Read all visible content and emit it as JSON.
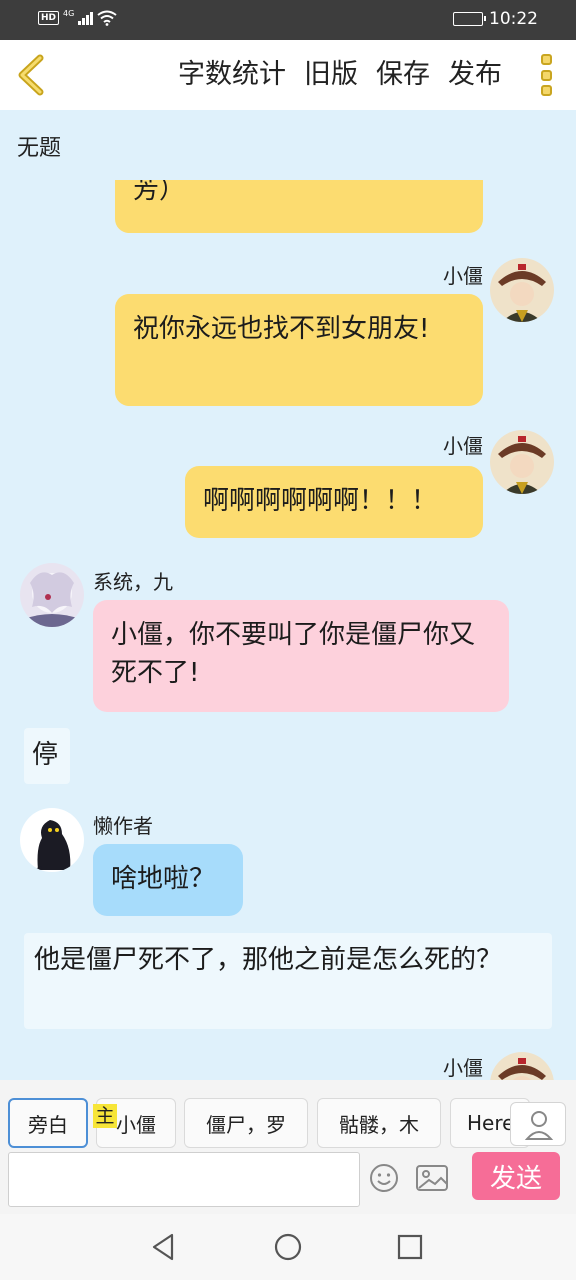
{
  "status_bar": {
    "hd": "HD",
    "network": "4G",
    "time": "10:22",
    "battery_level": 0.9
  },
  "toolbar": {
    "word_count": "字数统计",
    "old_version": "旧版",
    "save": "保存",
    "publish": "发布",
    "back_icon": "chevron-left-icon",
    "more_icon": "more-vertical-icon",
    "accent_color": "#f4d76a"
  },
  "story": {
    "title": "无题"
  },
  "messages": [
    {
      "type": "yellow",
      "text": "芳）"
    },
    {
      "type": "yellow",
      "speaker": "小僵",
      "text": "祝你永远也找不到女朋友!"
    },
    {
      "type": "yellow",
      "speaker": "小僵",
      "text": "啊啊啊啊啊啊！！！"
    },
    {
      "type": "pink",
      "speaker": "系统，九",
      "text": "小僵，你不要叫了你是僵尸你又死不了!"
    },
    {
      "type": "narration",
      "text": "停"
    },
    {
      "type": "blue",
      "speaker": "懒作者",
      "text": "啥地啦？"
    },
    {
      "type": "narration",
      "text": "他是僵尸死不了，那他之前是怎么死的？"
    },
    {
      "type": "yellow",
      "speaker": "小僵"
    }
  ],
  "roles": {
    "narrator": "旁白",
    "host_tag": "主",
    "items": [
      "小僵",
      "僵尸，罗",
      "骷髅，木",
      "Here"
    ]
  },
  "input": {
    "value": "",
    "placeholder": ""
  },
  "send_label": "发送",
  "colors": {
    "send": "#f66d97",
    "yellow_bubble": "#fcdc70",
    "pink_bubble": "#fdd1dc",
    "blue_bubble": "#a7dcfb",
    "background": "#dff1fb"
  }
}
